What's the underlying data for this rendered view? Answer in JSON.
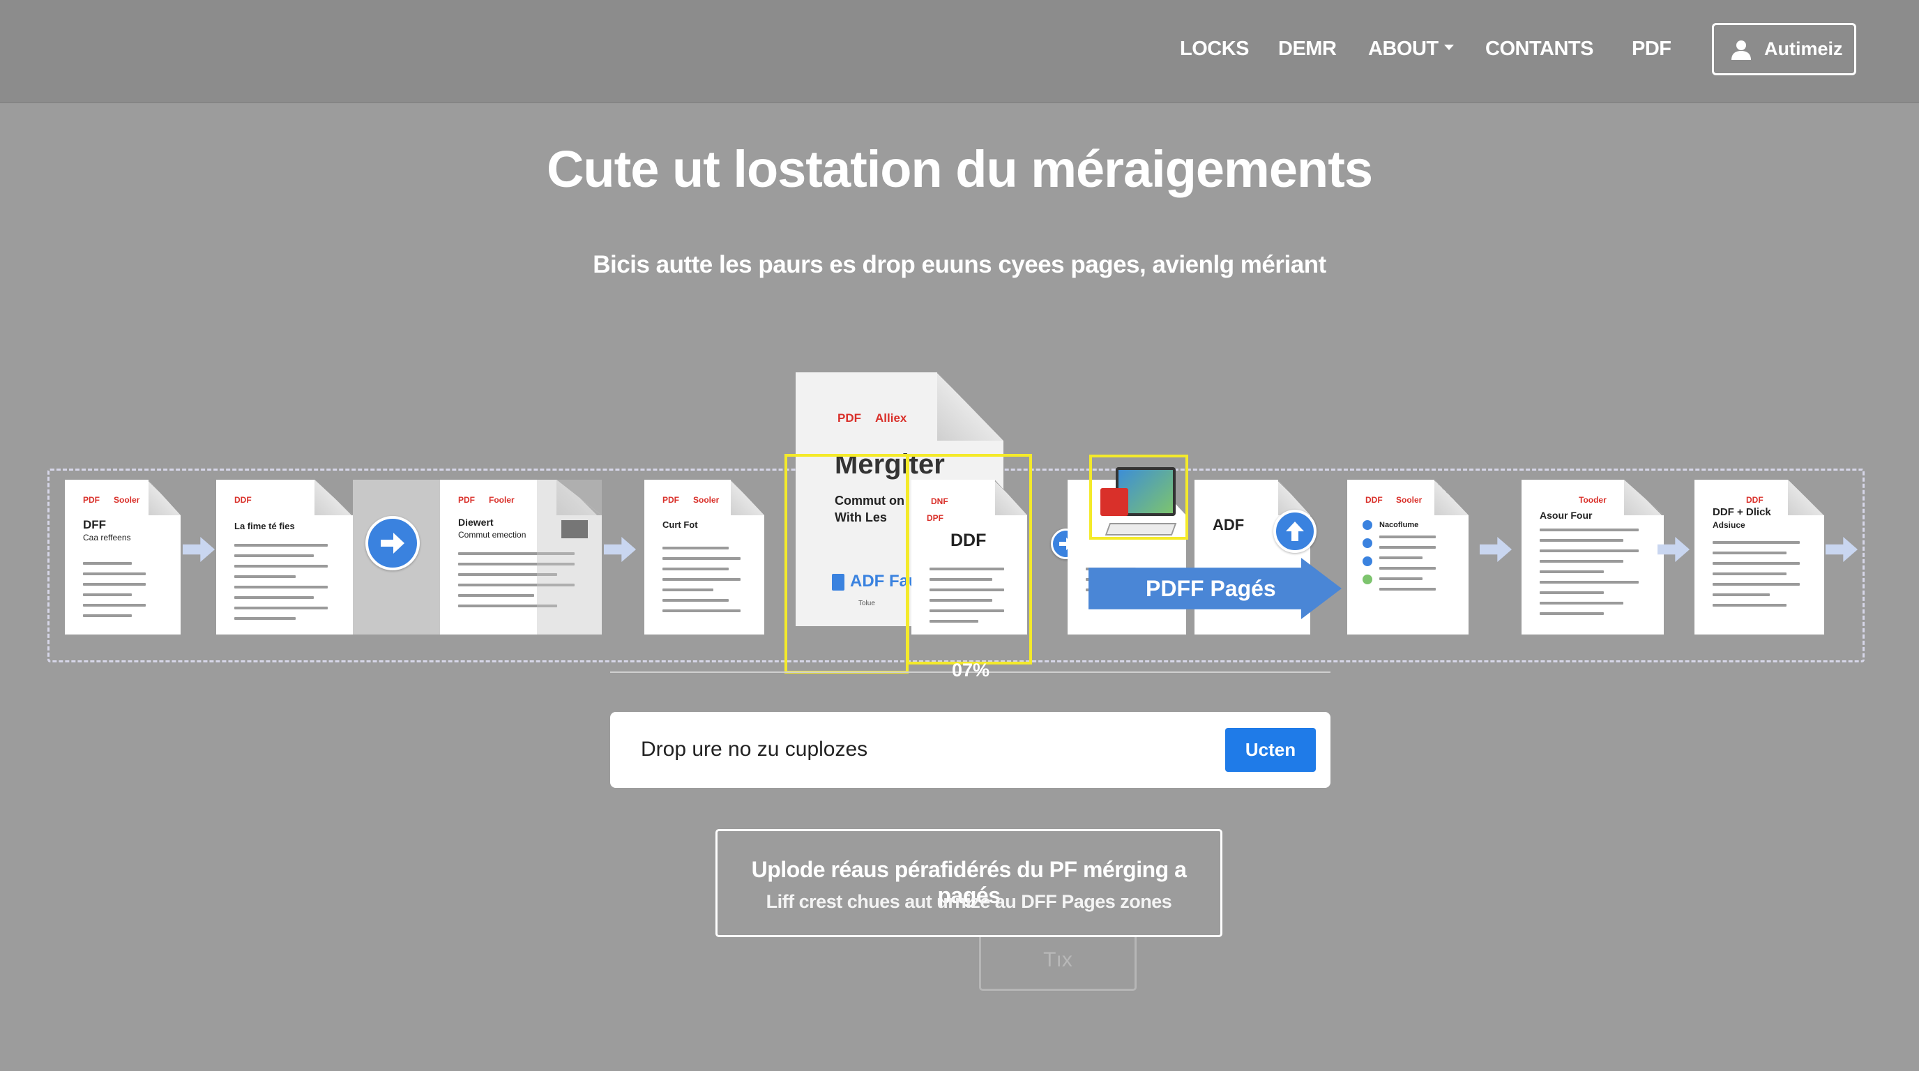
{
  "nav": {
    "items": [
      "LOCKS",
      "DEMR",
      "ABOUT",
      "CONTANTS",
      "PDF"
    ],
    "account_label": "Autimeiz"
  },
  "hero": {
    "title": "Cute ut lostation du méraigements",
    "subtitle": "Bicis autte les paurs es drop euuns cyees pages, avienlg mériant"
  },
  "docs": {
    "d1": {
      "tag": "PDF",
      "tag2": "Sooler",
      "title_1": "DFF",
      "title_2": "Caa reffeens"
    },
    "d2": {
      "tag": "DDF",
      "title_1": "La fime té fies"
    },
    "d3": {
      "tag": "PDF",
      "tag2": "Fooler",
      "title_1": "Diewert",
      "title_2": "Commut emection"
    },
    "d4": {
      "tag": "PDF",
      "tag2": "Sooler",
      "title_1": "Curt Fot"
    },
    "big": {
      "tag": "PDF",
      "tag2": "Alliex",
      "title": "Mergiter",
      "line_1": "Commut on",
      "line_2": "With Les",
      "link": "ADF Fau",
      "foot": "Tolue"
    },
    "d5": {
      "tag": "DNF",
      "tag2": "DPF",
      "title_1": "DDF"
    },
    "d6": {
      "title_1": "ADF"
    },
    "d7": {
      "tag": "DDF",
      "tag2": "Sooler",
      "title_1": "Nacoflume"
    },
    "d8": {
      "tag2": "Tooder",
      "title_1": "Asour Four"
    },
    "d9": {
      "tag2": "DDF",
      "title_1": "DDF + Dlick",
      "title_2": "Adsiuce"
    }
  },
  "merge_label": "PDFF Pagés",
  "progress_label": "07%",
  "upload": {
    "placeholder": "Drop ure no zu cuplozes",
    "button": "Ucten"
  },
  "info": {
    "line1": "Uplode réaus pérafidérés du PF mérging a pagés",
    "line2": "Liff crest chues aut urnize au DFF Pages zones"
  },
  "ghost_button": "Tıx",
  "colors": {
    "background": "#9c9c9c",
    "header": "#8c8c8c",
    "accent": "#1f7be8",
    "highlight": "#f4ea2a",
    "pdf_red": "#d9302a"
  }
}
